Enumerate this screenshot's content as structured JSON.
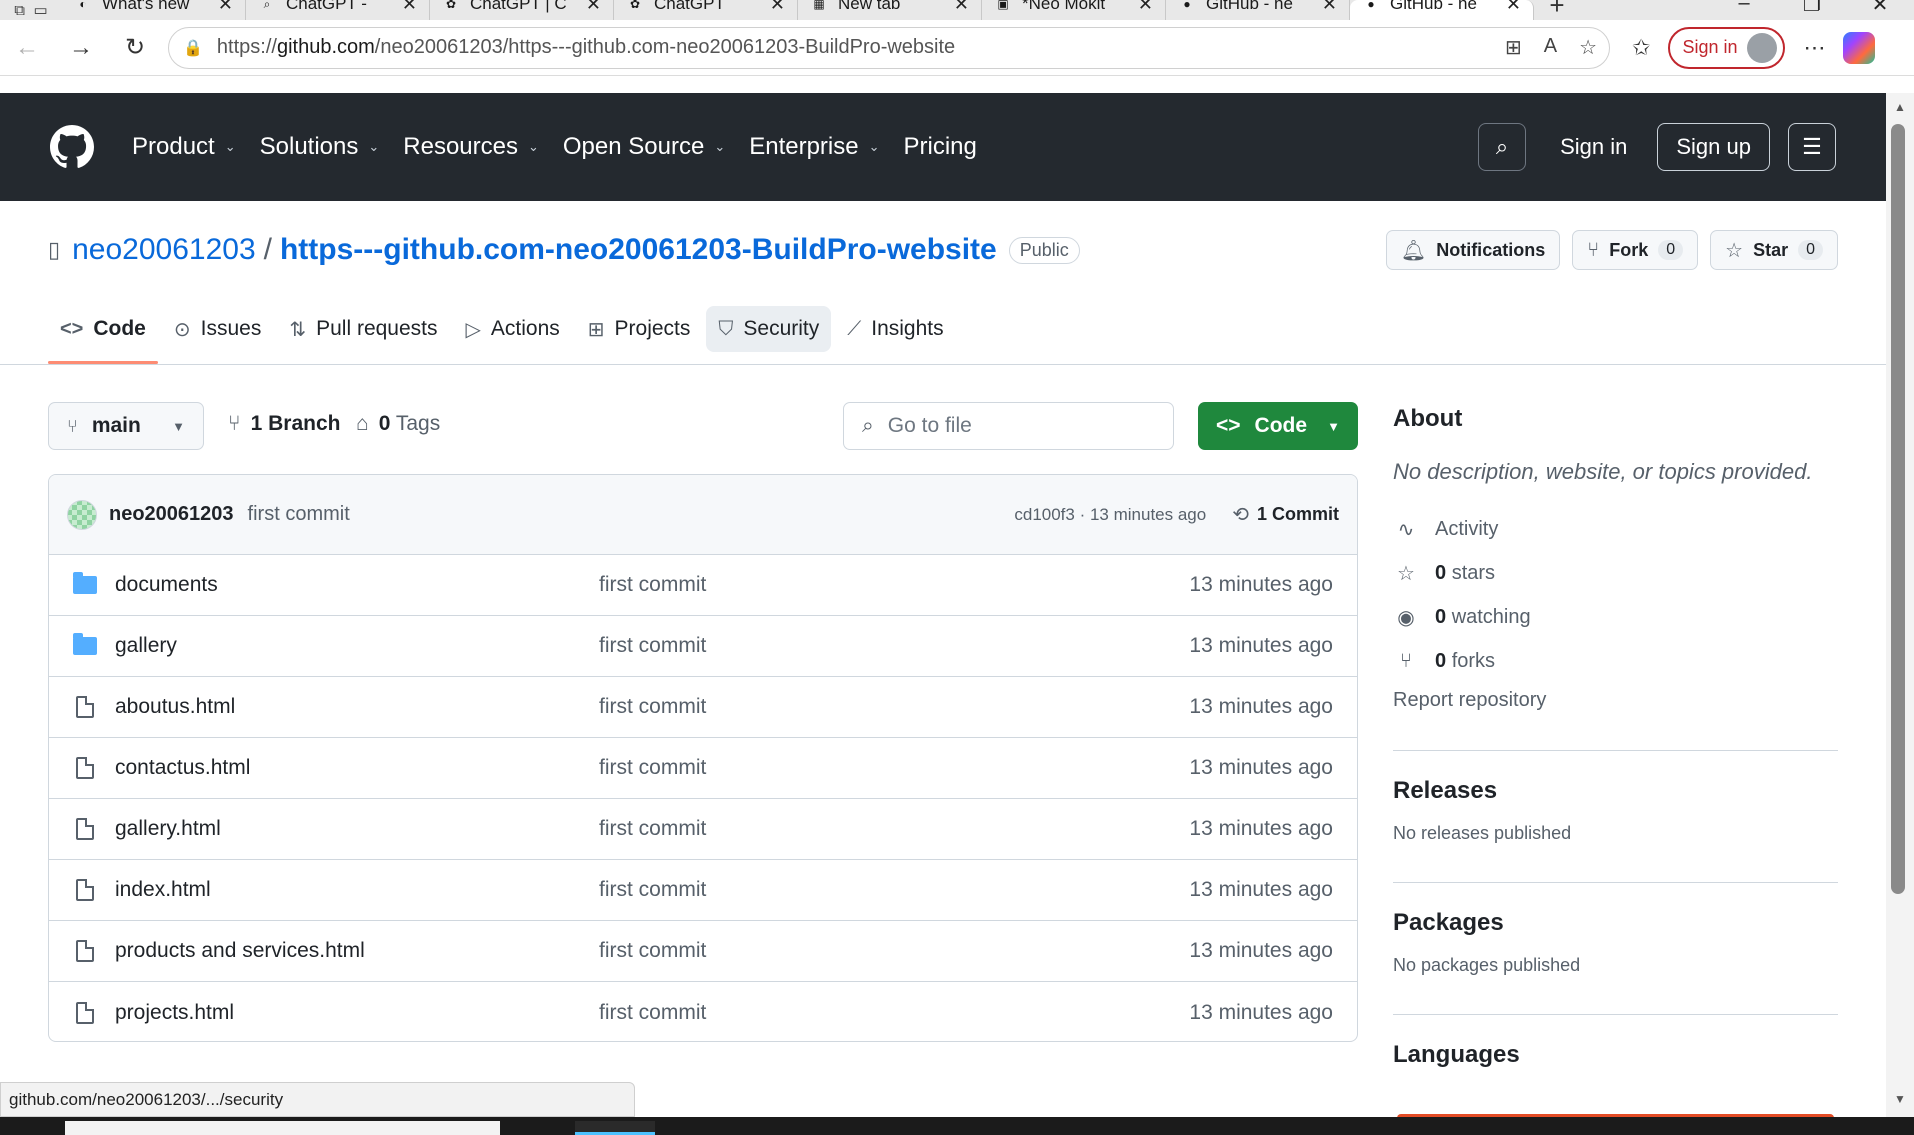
{
  "browser": {
    "tabs": [
      {
        "label": "What's new",
        "icon": "edge-icon"
      },
      {
        "label": "ChatGPT - ",
        "icon": "search-icon"
      },
      {
        "label": "ChatGPT | C",
        "icon": "chatgpt-icon"
      },
      {
        "label": "ChatGPT",
        "icon": "chatgpt-icon"
      },
      {
        "label": "New tab",
        "icon": "newtab-icon"
      },
      {
        "label": "*Neo Mokit",
        "icon": "pdf-icon"
      },
      {
        "label": "GitHub - ne",
        "icon": "github-icon"
      },
      {
        "label": "GitHub - ne",
        "icon": "github-icon",
        "active": true
      }
    ],
    "url_prefix": "https://",
    "url_host": "github.com",
    "url_path": "/neo20061203/https---github.com-neo20061203-BuildPro-website",
    "signin_label": "Sign in",
    "status_url": "github.com/neo20061203/.../security"
  },
  "gh_header": {
    "nav": [
      "Product",
      "Solutions",
      "Resources",
      "Open Source",
      "Enterprise",
      "Pricing"
    ],
    "nav_has_dropdown": [
      true,
      true,
      true,
      true,
      true,
      false
    ],
    "signin": "Sign in",
    "signup": "Sign up"
  },
  "repo": {
    "owner": "neo20061203",
    "name": "https---github.com-neo20061203-BuildPro-website",
    "visibility": "Public",
    "notifications_label": "Notifications",
    "fork_label": "Fork",
    "fork_count": "0",
    "star_label": "Star",
    "star_count": "0"
  },
  "repo_tabs": [
    {
      "label": "Code",
      "icon": "code-icon",
      "active": true
    },
    {
      "label": "Issues",
      "icon": "issue-icon"
    },
    {
      "label": "Pull requests",
      "icon": "pull-request-icon"
    },
    {
      "label": "Actions",
      "icon": "play-icon"
    },
    {
      "label": "Projects",
      "icon": "table-icon"
    },
    {
      "label": "Security",
      "icon": "shield-icon",
      "hover": true
    },
    {
      "label": "Insights",
      "icon": "graph-icon"
    }
  ],
  "toolbar": {
    "branch": "main",
    "branches_count": "1",
    "branches_label": "Branch",
    "tags_count": "0",
    "tags_label": "Tags",
    "goto_placeholder": "Go to file",
    "code_button": "Code"
  },
  "latest_commit": {
    "author": "neo20061203",
    "message": "first commit",
    "hash_age": "cd100f3 · 13 minutes ago",
    "commits_label": "1 Commit"
  },
  "files": [
    {
      "name": "documents",
      "type": "folder",
      "commit": "first commit",
      "age": "13 minutes ago"
    },
    {
      "name": "gallery",
      "type": "folder",
      "commit": "first commit",
      "age": "13 minutes ago"
    },
    {
      "name": "aboutus.html",
      "type": "file",
      "commit": "first commit",
      "age": "13 minutes ago"
    },
    {
      "name": "contactus.html",
      "type": "file",
      "commit": "first commit",
      "age": "13 minutes ago"
    },
    {
      "name": "gallery.html",
      "type": "file",
      "commit": "first commit",
      "age": "13 minutes ago"
    },
    {
      "name": "index.html",
      "type": "file",
      "commit": "first commit",
      "age": "13 minutes ago"
    },
    {
      "name": "products and services.html",
      "type": "file",
      "commit": "first commit",
      "age": "13 minutes ago"
    },
    {
      "name": "projects.html",
      "type": "file",
      "commit": "first commit",
      "age": "13 minutes ago"
    }
  ],
  "about": {
    "heading": "About",
    "description": "No description, website, or topics provided.",
    "activity": "Activity",
    "stars_count": "0",
    "stars_label": "stars",
    "watching_count": "0",
    "watching_label": "watching",
    "forks_count": "0",
    "forks_label": "forks",
    "report": "Report repository"
  },
  "releases": {
    "heading": "Releases",
    "text": "No releases published"
  },
  "packages": {
    "heading": "Packages",
    "text": "No packages published"
  },
  "languages": {
    "heading": "Languages"
  },
  "colors": {
    "header_bg": "#24292f",
    "link": "#0969da",
    "code_green": "#1f883d",
    "tab_underline": "#fd8c73",
    "folder": "#54aeff"
  }
}
